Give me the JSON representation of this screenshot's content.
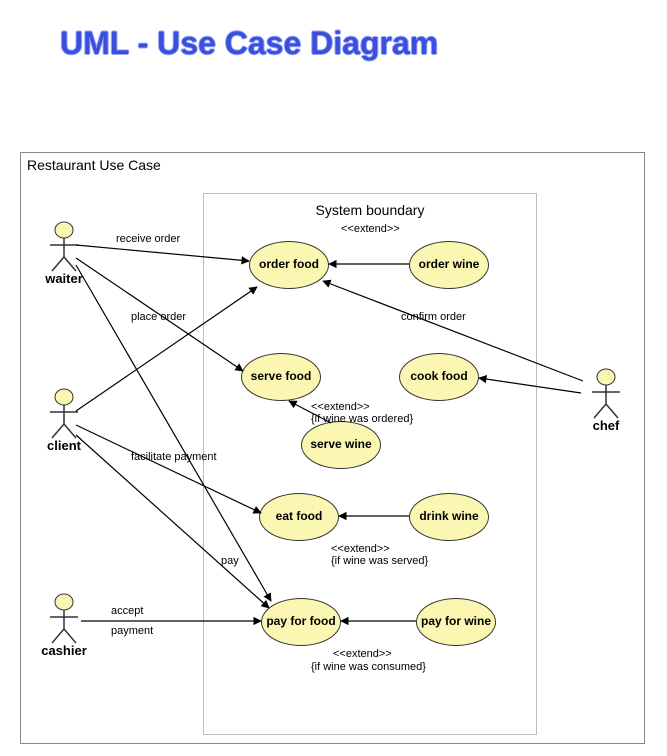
{
  "title": "UML - Use Case Diagram",
  "diagram": {
    "outer_label": "Restaurant Use Case",
    "system_boundary_label": "System boundary",
    "actors": {
      "waiter": "waiter",
      "client": "client",
      "cashier": "cashier",
      "chef": "chef"
    },
    "usecases": {
      "order_food": "order food",
      "order_wine": "order wine",
      "serve_food": "serve food",
      "cook_food": "cook food",
      "serve_wine": "serve wine",
      "eat_food": "eat food",
      "drink_wine": "drink wine",
      "pay_for_food": "pay for food",
      "pay_for_wine": "pay for wine"
    },
    "assoc_labels": {
      "receive_order": "receive order",
      "place_order": "place order",
      "facilitate_payment": "facilitate payment",
      "pay": "pay",
      "accept": "accept",
      "payment": "payment",
      "confirm_order": "confirm order"
    },
    "extend_labels": {
      "extend": "<<extend>>",
      "if_ordered": "{if wine was ordered}",
      "if_served": "{if wine was served}",
      "if_consumed": "{if wine was consumed}"
    }
  }
}
